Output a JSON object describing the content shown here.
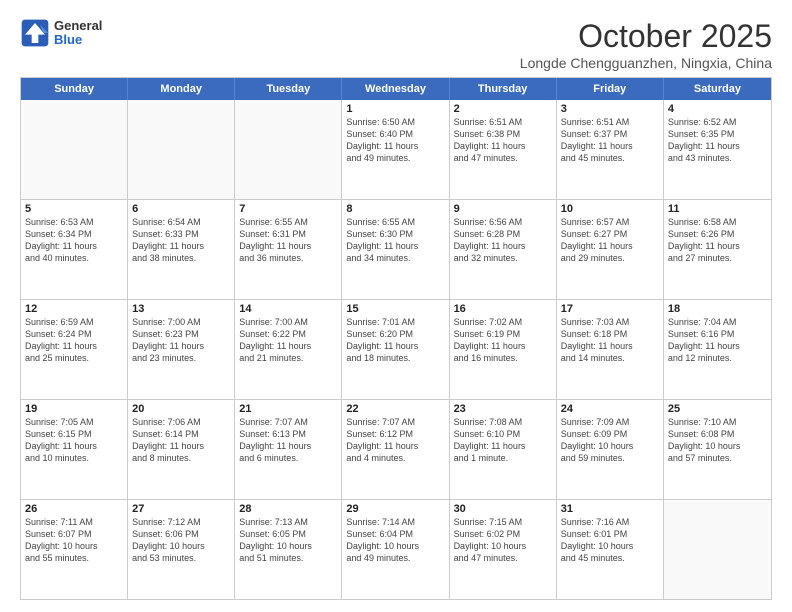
{
  "logo": {
    "general": "General",
    "blue": "Blue"
  },
  "header": {
    "month": "October 2025",
    "location": "Longde Chengguanzhen, Ningxia, China"
  },
  "weekdays": [
    "Sunday",
    "Monday",
    "Tuesday",
    "Wednesday",
    "Thursday",
    "Friday",
    "Saturday"
  ],
  "rows": [
    [
      {
        "day": "",
        "lines": []
      },
      {
        "day": "",
        "lines": []
      },
      {
        "day": "",
        "lines": []
      },
      {
        "day": "1",
        "lines": [
          "Sunrise: 6:50 AM",
          "Sunset: 6:40 PM",
          "Daylight: 11 hours",
          "and 49 minutes."
        ]
      },
      {
        "day": "2",
        "lines": [
          "Sunrise: 6:51 AM",
          "Sunset: 6:38 PM",
          "Daylight: 11 hours",
          "and 47 minutes."
        ]
      },
      {
        "day": "3",
        "lines": [
          "Sunrise: 6:51 AM",
          "Sunset: 6:37 PM",
          "Daylight: 11 hours",
          "and 45 minutes."
        ]
      },
      {
        "day": "4",
        "lines": [
          "Sunrise: 6:52 AM",
          "Sunset: 6:35 PM",
          "Daylight: 11 hours",
          "and 43 minutes."
        ]
      }
    ],
    [
      {
        "day": "5",
        "lines": [
          "Sunrise: 6:53 AM",
          "Sunset: 6:34 PM",
          "Daylight: 11 hours",
          "and 40 minutes."
        ]
      },
      {
        "day": "6",
        "lines": [
          "Sunrise: 6:54 AM",
          "Sunset: 6:33 PM",
          "Daylight: 11 hours",
          "and 38 minutes."
        ]
      },
      {
        "day": "7",
        "lines": [
          "Sunrise: 6:55 AM",
          "Sunset: 6:31 PM",
          "Daylight: 11 hours",
          "and 36 minutes."
        ]
      },
      {
        "day": "8",
        "lines": [
          "Sunrise: 6:55 AM",
          "Sunset: 6:30 PM",
          "Daylight: 11 hours",
          "and 34 minutes."
        ]
      },
      {
        "day": "9",
        "lines": [
          "Sunrise: 6:56 AM",
          "Sunset: 6:28 PM",
          "Daylight: 11 hours",
          "and 32 minutes."
        ]
      },
      {
        "day": "10",
        "lines": [
          "Sunrise: 6:57 AM",
          "Sunset: 6:27 PM",
          "Daylight: 11 hours",
          "and 29 minutes."
        ]
      },
      {
        "day": "11",
        "lines": [
          "Sunrise: 6:58 AM",
          "Sunset: 6:26 PM",
          "Daylight: 11 hours",
          "and 27 minutes."
        ]
      }
    ],
    [
      {
        "day": "12",
        "lines": [
          "Sunrise: 6:59 AM",
          "Sunset: 6:24 PM",
          "Daylight: 11 hours",
          "and 25 minutes."
        ]
      },
      {
        "day": "13",
        "lines": [
          "Sunrise: 7:00 AM",
          "Sunset: 6:23 PM",
          "Daylight: 11 hours",
          "and 23 minutes."
        ]
      },
      {
        "day": "14",
        "lines": [
          "Sunrise: 7:00 AM",
          "Sunset: 6:22 PM",
          "Daylight: 11 hours",
          "and 21 minutes."
        ]
      },
      {
        "day": "15",
        "lines": [
          "Sunrise: 7:01 AM",
          "Sunset: 6:20 PM",
          "Daylight: 11 hours",
          "and 18 minutes."
        ]
      },
      {
        "day": "16",
        "lines": [
          "Sunrise: 7:02 AM",
          "Sunset: 6:19 PM",
          "Daylight: 11 hours",
          "and 16 minutes."
        ]
      },
      {
        "day": "17",
        "lines": [
          "Sunrise: 7:03 AM",
          "Sunset: 6:18 PM",
          "Daylight: 11 hours",
          "and 14 minutes."
        ]
      },
      {
        "day": "18",
        "lines": [
          "Sunrise: 7:04 AM",
          "Sunset: 6:16 PM",
          "Daylight: 11 hours",
          "and 12 minutes."
        ]
      }
    ],
    [
      {
        "day": "19",
        "lines": [
          "Sunrise: 7:05 AM",
          "Sunset: 6:15 PM",
          "Daylight: 11 hours",
          "and 10 minutes."
        ]
      },
      {
        "day": "20",
        "lines": [
          "Sunrise: 7:06 AM",
          "Sunset: 6:14 PM",
          "Daylight: 11 hours",
          "and 8 minutes."
        ]
      },
      {
        "day": "21",
        "lines": [
          "Sunrise: 7:07 AM",
          "Sunset: 6:13 PM",
          "Daylight: 11 hours",
          "and 6 minutes."
        ]
      },
      {
        "day": "22",
        "lines": [
          "Sunrise: 7:07 AM",
          "Sunset: 6:12 PM",
          "Daylight: 11 hours",
          "and 4 minutes."
        ]
      },
      {
        "day": "23",
        "lines": [
          "Sunrise: 7:08 AM",
          "Sunset: 6:10 PM",
          "Daylight: 11 hours",
          "and 1 minute."
        ]
      },
      {
        "day": "24",
        "lines": [
          "Sunrise: 7:09 AM",
          "Sunset: 6:09 PM",
          "Daylight: 10 hours",
          "and 59 minutes."
        ]
      },
      {
        "day": "25",
        "lines": [
          "Sunrise: 7:10 AM",
          "Sunset: 6:08 PM",
          "Daylight: 10 hours",
          "and 57 minutes."
        ]
      }
    ],
    [
      {
        "day": "26",
        "lines": [
          "Sunrise: 7:11 AM",
          "Sunset: 6:07 PM",
          "Daylight: 10 hours",
          "and 55 minutes."
        ]
      },
      {
        "day": "27",
        "lines": [
          "Sunrise: 7:12 AM",
          "Sunset: 6:06 PM",
          "Daylight: 10 hours",
          "and 53 minutes."
        ]
      },
      {
        "day": "28",
        "lines": [
          "Sunrise: 7:13 AM",
          "Sunset: 6:05 PM",
          "Daylight: 10 hours",
          "and 51 minutes."
        ]
      },
      {
        "day": "29",
        "lines": [
          "Sunrise: 7:14 AM",
          "Sunset: 6:04 PM",
          "Daylight: 10 hours",
          "and 49 minutes."
        ]
      },
      {
        "day": "30",
        "lines": [
          "Sunrise: 7:15 AM",
          "Sunset: 6:02 PM",
          "Daylight: 10 hours",
          "and 47 minutes."
        ]
      },
      {
        "day": "31",
        "lines": [
          "Sunrise: 7:16 AM",
          "Sunset: 6:01 PM",
          "Daylight: 10 hours",
          "and 45 minutes."
        ]
      },
      {
        "day": "",
        "lines": []
      }
    ]
  ]
}
